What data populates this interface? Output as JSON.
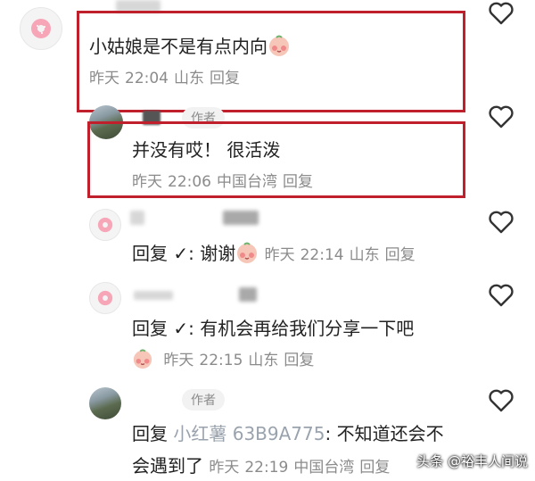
{
  "comments": [
    {
      "text": "小姑娘是不是有点内向",
      "date": "昨天",
      "time": "22:04",
      "location": "山东",
      "reply": "回复"
    },
    {
      "author_badge": "作者",
      "text": "并没有哎！ 很活泼",
      "date": "昨天",
      "time": "22:06",
      "location": "中国台湾",
      "reply": "回复"
    },
    {
      "prefix": "回复",
      "check": "✓",
      "text": ": 谢谢",
      "date": "昨天",
      "time": "22:14",
      "location": "山东",
      "reply": "回复"
    },
    {
      "prefix": "回复",
      "check": "✓",
      "text": ": 有机会再给我们分享一下吧",
      "date": "昨天",
      "time": "22:15",
      "location": "山东",
      "reply": "回复"
    },
    {
      "author_badge": "作者",
      "prefix": "回复",
      "target_user": "小红薯 63B9A775",
      "text_line1": ": 不知道还会不",
      "text_line2": "会遇到了",
      "date": "昨天",
      "time": "22:19",
      "location": "中国台湾",
      "reply": "回复"
    }
  ],
  "watermark": "头条 @裕丰人间说",
  "colors": {
    "highlight_box": "#c01f2c",
    "meta_text": "#8b8b8b",
    "main_text": "#222222"
  },
  "icons": [
    "donut-avatar-icon",
    "heart-outline-icon",
    "blush-emoji-icon"
  ]
}
